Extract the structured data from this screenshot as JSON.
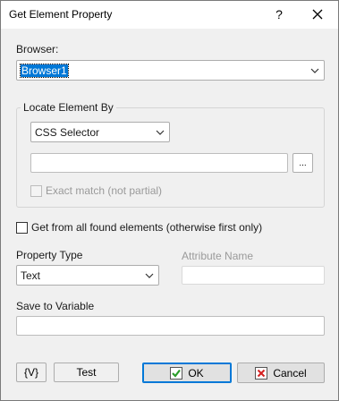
{
  "window": {
    "title": "Get Element Property",
    "help_label": "?"
  },
  "browser": {
    "label": "Browser:",
    "value": "Browser1"
  },
  "locate": {
    "group_label": "Locate Element By",
    "method_value": "CSS Selector",
    "selector_value": "",
    "browse_label": "...",
    "exact_match_label": "Exact match (not partial)",
    "exact_match_checked": false
  },
  "all_found": {
    "label": "Get from all found elements (otherwise first only)",
    "checked": false
  },
  "property": {
    "type_label": "Property Type",
    "type_value": "Text",
    "attribute_label": "Attribute Name",
    "attribute_value": ""
  },
  "save": {
    "label": "Save to Variable",
    "value": ""
  },
  "buttons": {
    "variables_label": "{V}",
    "test_label": "Test",
    "ok_label": "OK",
    "cancel_label": "Cancel"
  },
  "colors": {
    "accent": "#0078d7",
    "ok_icon": "#2a9d2a",
    "cancel_icon": "#d42020"
  }
}
